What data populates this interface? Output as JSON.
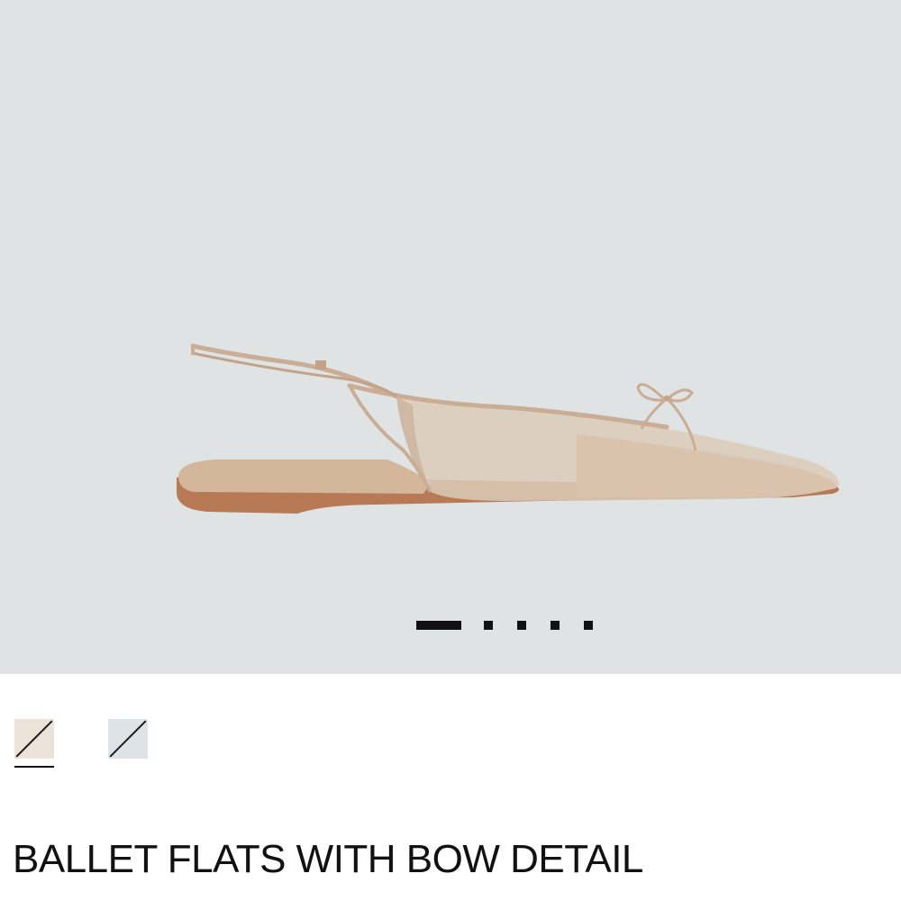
{
  "product": {
    "title": "BALLET FLATS WITH BOW DETAIL"
  },
  "gallery": {
    "image_icon": "ballet-flat-slingback-image",
    "background_color": "#dfe3e4",
    "image_count": 5,
    "active_index": 0
  },
  "colors": {
    "selected_index": 0,
    "swatches": [
      {
        "color": "#ece3d8"
      },
      {
        "color": "#dde3e7"
      }
    ]
  }
}
